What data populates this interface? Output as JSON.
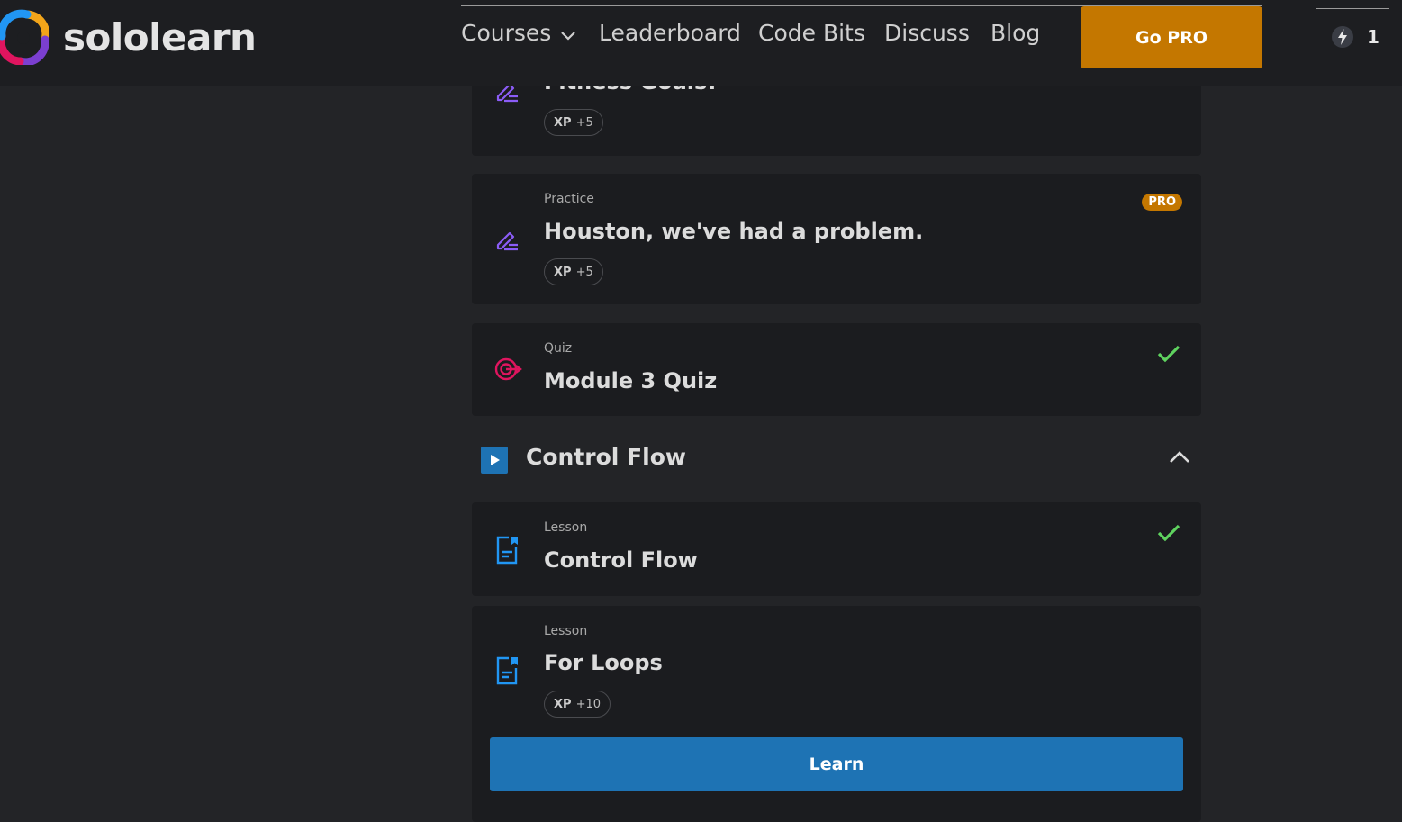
{
  "header": {
    "brand": "sololearn",
    "nav": {
      "courses": "Courses",
      "leaderboard": "Leaderboard",
      "code_bits": "Code Bits",
      "discuss": "Discuss",
      "blog": "Blog"
    },
    "go_pro": "Go PRO",
    "streak_count": "1"
  },
  "colors": {
    "background": "#232427",
    "card": "#1b1c1f",
    "accent_blue": "#1e73b4",
    "pro_orange": "#c47700",
    "check_green": "#5fd35f",
    "practice_purple": "#8b5cf6",
    "quiz_red": "#e0155f"
  },
  "items": [
    {
      "type": "",
      "title": "Fitness Goals!",
      "xp_label": "XP",
      "xp_value": "+5",
      "icon": "practice-pencil-icon"
    },
    {
      "type": "Practice",
      "title": "Houston, we've had a problem.",
      "xp_label": "XP",
      "xp_value": "+5",
      "badge": "PRO",
      "icon": "practice-pencil-icon"
    },
    {
      "type": "Quiz",
      "title": "Module 3 Quiz",
      "completed": true,
      "icon": "quiz-target-icon"
    }
  ],
  "section": {
    "title": "Control Flow",
    "expanded": true,
    "items": [
      {
        "type": "Lesson",
        "title": "Control Flow",
        "completed": true,
        "icon": "lesson-document-icon"
      },
      {
        "type": "Lesson",
        "title": "For Loops",
        "xp_label": "XP",
        "xp_value": "+10",
        "button": "Learn",
        "icon": "lesson-document-icon"
      }
    ]
  }
}
